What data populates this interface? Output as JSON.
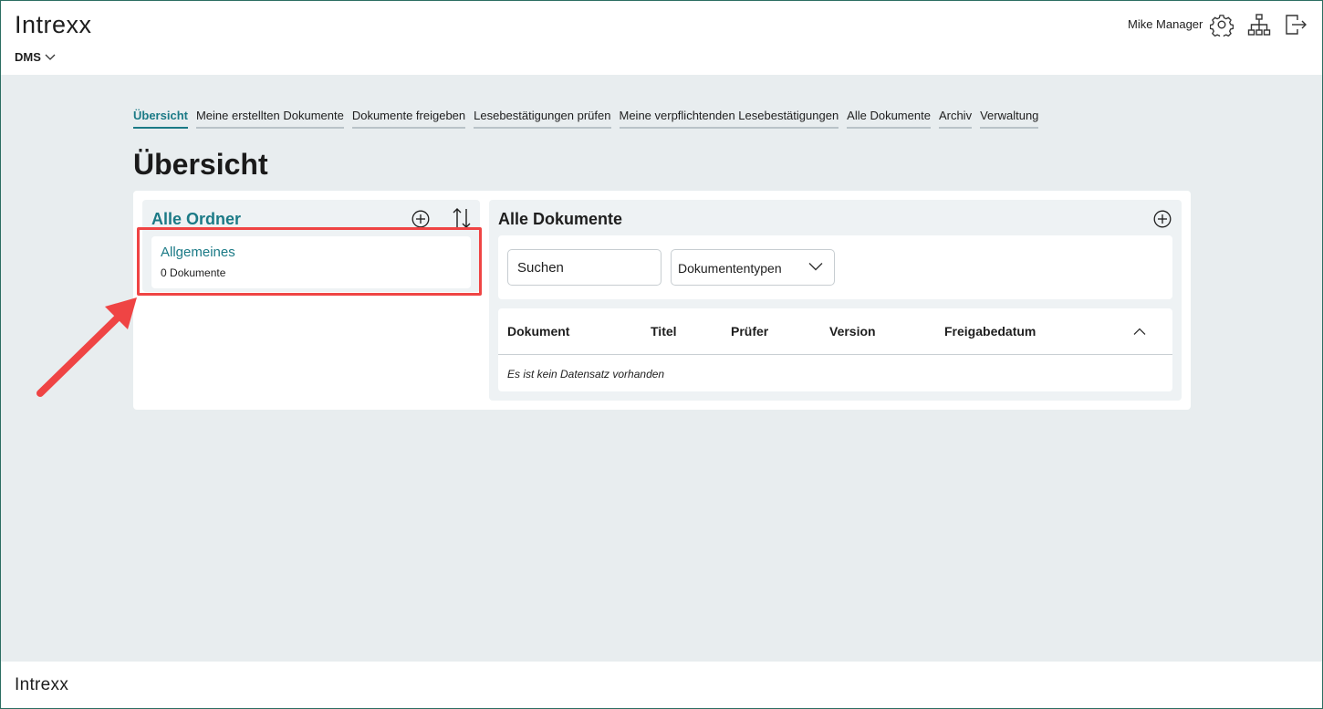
{
  "header": {
    "logo": "Intrexx",
    "app_switch": "DMS",
    "user_name": "Mike Manager",
    "icons": [
      "gear-icon",
      "sitemap-icon",
      "logout-icon"
    ]
  },
  "tabs": [
    {
      "label": "Übersicht",
      "active": true
    },
    {
      "label": "Meine erstellten Dokumente",
      "active": false
    },
    {
      "label": "Dokumente freigeben",
      "active": false
    },
    {
      "label": "Lesebestätigungen prüfen",
      "active": false
    },
    {
      "label": "Meine verpflichtenden Lesebestätigungen",
      "active": false
    },
    {
      "label": "Alle Dokumente",
      "active": false
    },
    {
      "label": "Archiv",
      "active": false
    },
    {
      "label": "Verwaltung",
      "active": false
    }
  ],
  "page_title": "Übersicht",
  "folders_panel": {
    "title": "Alle Ordner",
    "items": [
      {
        "name": "Allgemeines",
        "count": "0",
        "count_label": "Dokumente"
      }
    ]
  },
  "documents_panel": {
    "title": "Alle Dokumente",
    "search": {
      "placeholder": "Suchen",
      "value": ""
    },
    "doc_type_select": {
      "value": "Dokumententypen"
    },
    "columns": [
      "Dokument",
      "Titel",
      "Prüfer",
      "Version",
      "Freigabedatum"
    ],
    "empty_text": "Es ist kein Datensatz vorhanden"
  },
  "footer": {
    "logo": "Intrexx"
  },
  "colors": {
    "accent": "#1b7a86",
    "background": "#e8edef",
    "highlight": "#ef4444"
  }
}
